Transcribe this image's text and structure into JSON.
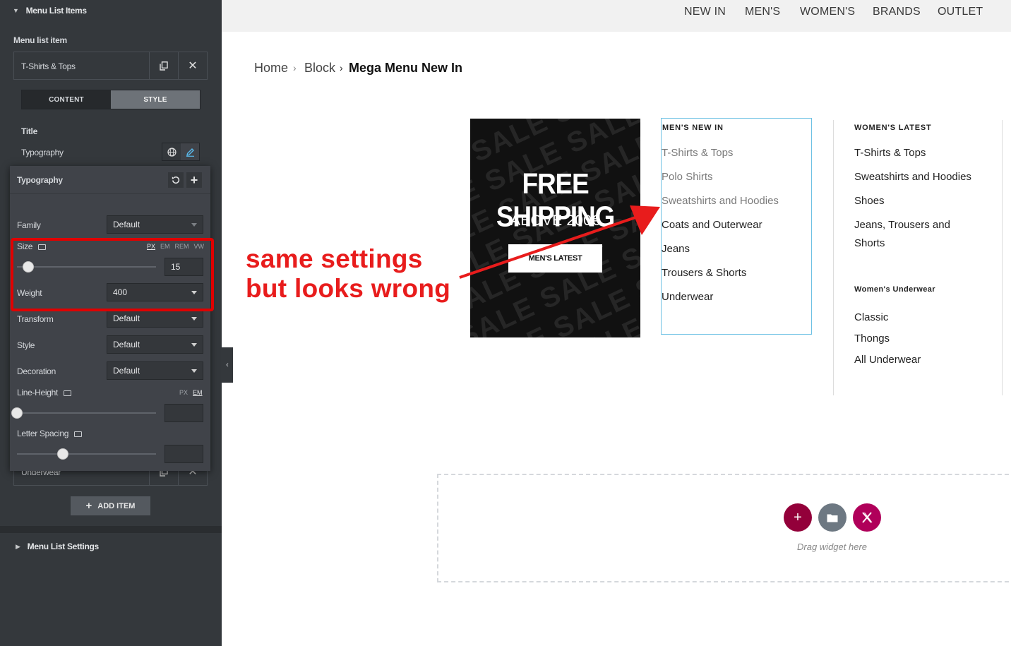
{
  "panel": {
    "section_title": "Menu List Items",
    "menu_list_item_label": "Menu list item",
    "item_title": "T-Shirts & Tops",
    "tabs": [
      "CONTENT",
      "STYLE"
    ],
    "title_heading": "Title",
    "typography_label": "Typography",
    "popup": {
      "title": "Typography",
      "family": {
        "label": "Family",
        "value": "Default"
      },
      "size": {
        "label": "Size",
        "units": [
          "PX",
          "EM",
          "REM",
          "VW"
        ],
        "value": "15",
        "level": 0.08
      },
      "weight": {
        "label": "Weight",
        "value": "400"
      },
      "transform": {
        "label": "Transform",
        "value": "Default"
      },
      "style": {
        "label": "Style",
        "value": "Default"
      },
      "decoration": {
        "label": "Decoration",
        "value": "Default"
      },
      "line_height": {
        "label": "Line-Height",
        "units": [
          "PX",
          "EM"
        ],
        "value": "",
        "level": 0.0
      },
      "letter_spacing": {
        "label": "Letter Spacing",
        "value": "",
        "level": 0.33
      }
    },
    "last_item_title": "Underwear",
    "add_item_label": "ADD ITEM",
    "settings_title": "Menu List Settings"
  },
  "topnav": [
    "NEW IN",
    "MEN'S",
    "WOMEN'S",
    "BRANDS",
    "OUTLET"
  ],
  "breadcrumb": {
    "home": "Home",
    "block": "Block",
    "current": "Mega Menu New In"
  },
  "promo": {
    "bg_text": "SALE",
    "title": "FREE SHIPPING",
    "subtitle": "ABOVE 200€",
    "button": "MEN'S LATEST"
  },
  "mens_new_in": {
    "title": "MEN'S NEW IN",
    "items": [
      "T-Shirts & Tops",
      "Polo Shirts",
      "Sweatshirts and Hoodies",
      "Coats and Outerwear",
      "Jeans",
      "Trousers & Shorts",
      "Underwear"
    ]
  },
  "womens_latest": {
    "title": "WOMEN'S LATEST",
    "items": [
      "T-Shirts & Tops",
      "Sweatshirts and Hoodies",
      "Shoes",
      "Jeans, Trousers and Shorts"
    ]
  },
  "womens_underwear": {
    "title": "Women's Underwear",
    "items": [
      "Classic",
      "Thongs",
      "All Underwear"
    ]
  },
  "annotation": {
    "line1": "same settings",
    "line2": "but looks wrong",
    "color": "#e81c1c"
  },
  "dropzone": {
    "text": "Drag widget here"
  },
  "colors": {
    "accent_pink": "#93003a",
    "grey_button": "#6d7882",
    "highlight_red": "#e00000",
    "column_border": "#6ec1e4"
  }
}
